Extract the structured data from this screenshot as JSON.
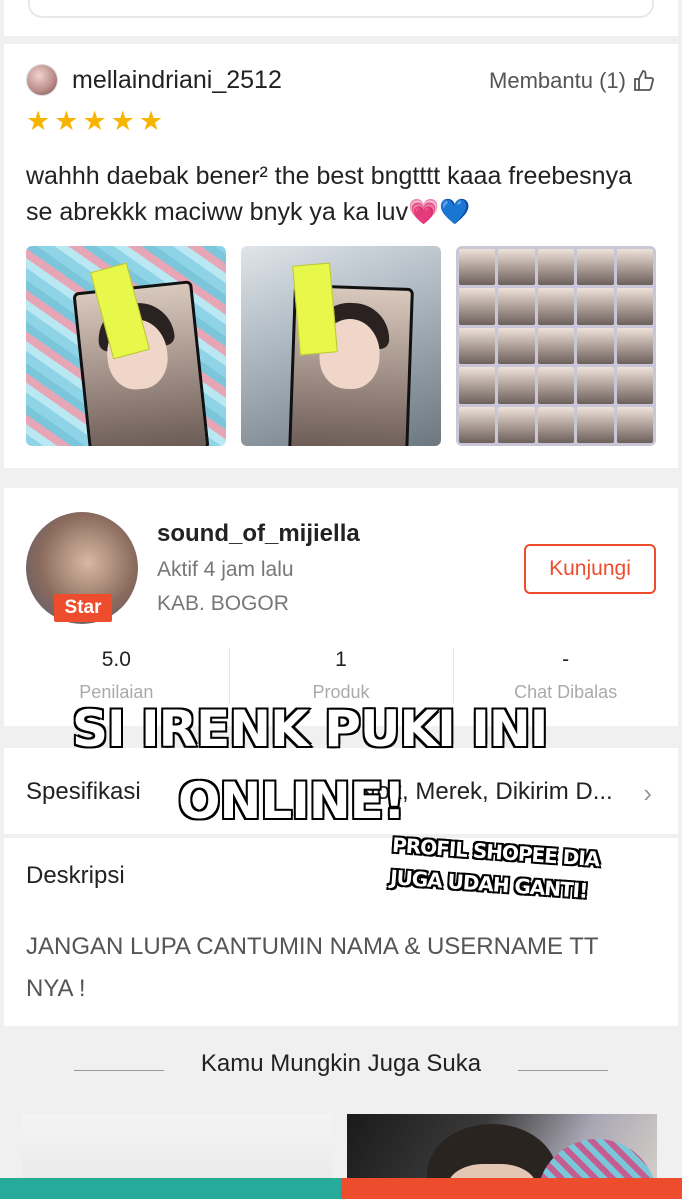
{
  "review": {
    "username": "mellaindriani_2512",
    "helpful_label": "Membantu (1)",
    "rating": 5,
    "text": "wahhh daebak bener² the best bngtttt kaaa freebesnya se abrekkk maciww bnyk ya ka luv💗💙"
  },
  "shop": {
    "name": "sound_of_mijiella",
    "badge": "Star",
    "active_status": "Aktif 4 jam lalu",
    "location": "KAB. BOGOR",
    "visit_button": "Kunjungi",
    "stats": [
      {
        "value": "5.0",
        "label": "Penilaian"
      },
      {
        "value": "1",
        "label": "Produk"
      },
      {
        "value": "-",
        "label": "Chat Dibalas"
      }
    ]
  },
  "spec": {
    "title": "Spesifikasi",
    "value": "Stok, Merek, Dikirim D..."
  },
  "description": {
    "title": "Deskripsi",
    "text": "JANGAN LUPA CANTUMIN NAMA & USERNAME TT NYA !"
  },
  "recommendations": {
    "header": "Kamu Mungkin Juga Suka"
  },
  "overlay": {
    "line1": "SI IRENK PUKI INI",
    "line2": "ONLINE!",
    "line3": "PROFIL SHOPEE DIA",
    "line4": "JUGA UDAH GANTI!"
  },
  "colors": {
    "accent": "#ee4d2d",
    "star": "#f7b500",
    "teal": "#26aa99"
  }
}
